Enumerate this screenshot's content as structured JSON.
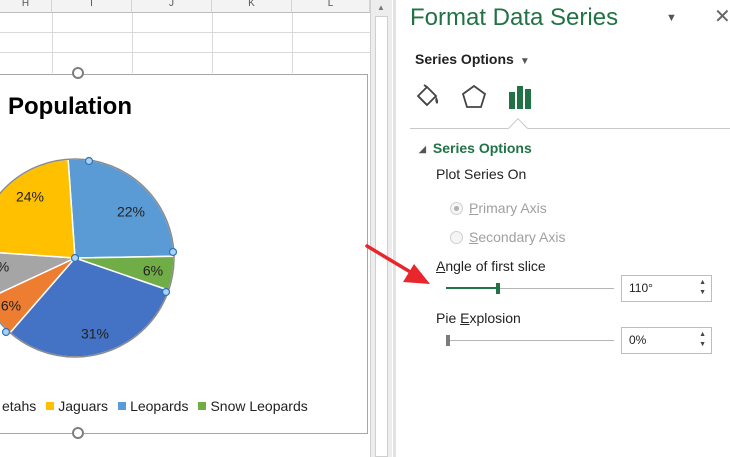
{
  "spreadsheet": {
    "column_headers": [
      "H",
      "I",
      "J",
      "K",
      "L"
    ],
    "chart": {
      "title": "Population",
      "slice_labels": [
        "24%",
        "22%",
        "6%",
        "31%",
        "6%",
        "%"
      ],
      "legend": [
        {
          "label": "etahs",
          "color": "#a5a5a5"
        },
        {
          "label": "Jaguars",
          "color": "#ffc000"
        },
        {
          "label": "Leopards",
          "color": "#5b9bd5"
        },
        {
          "label": "Snow Leopards",
          "color": "#70ad47"
        }
      ],
      "slice_colors": {
        "jaguars": "#ffc000",
        "leopards": "#5b9bd5",
        "snow_leopards": "#70ad47",
        "blue_dark": "#4472c4",
        "orange": "#ed7d31",
        "gray": "#a5a5a5"
      }
    }
  },
  "pane": {
    "title": "Format Data Series",
    "dropdown_label": "Series Options",
    "tab_icons": [
      "fill-line-icon",
      "effects-icon",
      "series-options-icon"
    ],
    "section_title": "Series Options",
    "plot_series_on_label": "Plot Series On",
    "radio_options": [
      {
        "label": "Primary Axis",
        "checked": true,
        "underline_char": "P"
      },
      {
        "label": "Secondary Axis",
        "checked": false,
        "underline_char": "S"
      }
    ],
    "angle": {
      "label": "Angle of first slice",
      "value": "110°",
      "slider_fraction": 0.31
    },
    "explosion": {
      "label": "Pie Explosion",
      "value": "0%",
      "slider_fraction": 0.0
    }
  },
  "accent_color": "#217346",
  "annotation_arrow_color": "#e8262c"
}
